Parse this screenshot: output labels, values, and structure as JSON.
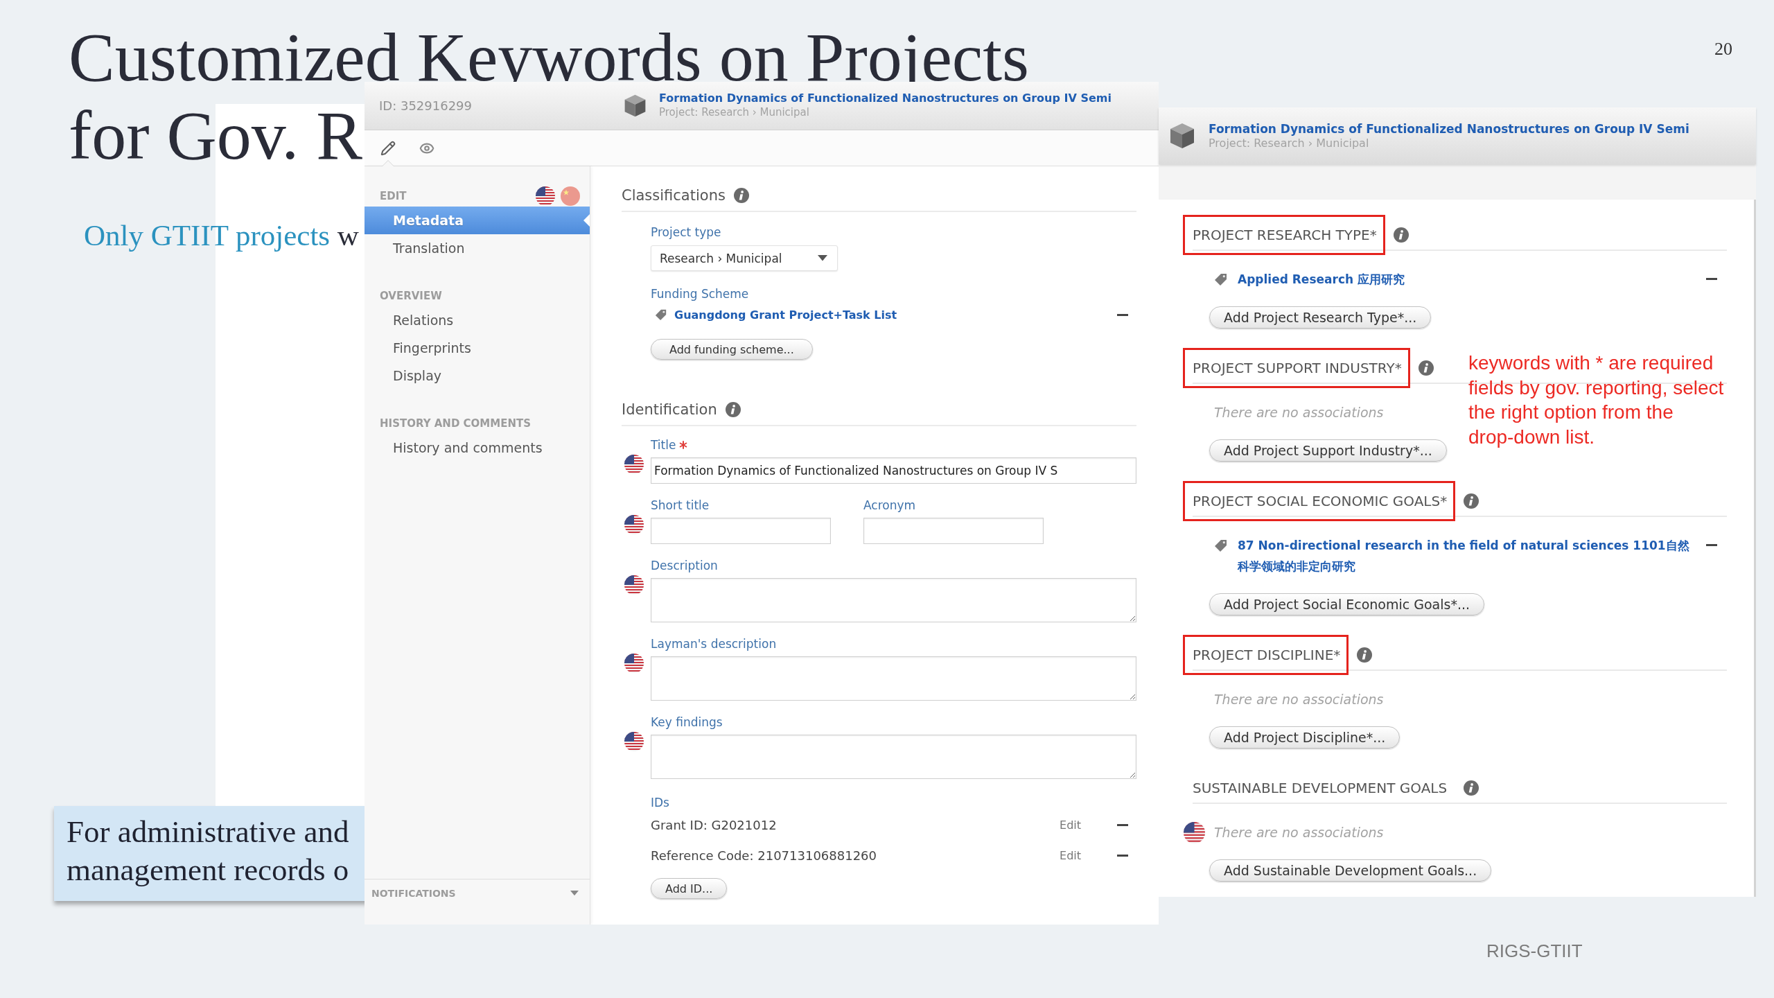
{
  "slide": {
    "title_lines": [
      "Customized Keywords on Projects",
      "for Gov. R"
    ],
    "page_number": "20",
    "intro": {
      "lead": "Only GTIIT projects",
      "rest": "w"
    },
    "callout_lines": [
      "For administrative and",
      "management records o"
    ],
    "annotation_lines": [
      "keywords with * are required",
      "fields by gov. reporting, select",
      "the right option from the",
      "drop-down list."
    ],
    "footer": "RIGS-GTIIT"
  },
  "editor": {
    "id_label": "ID: 352916299",
    "project_title": "Formation Dynamics of Functionalized Nanostructures on Group IV Semi",
    "project_subtitle": "Project: Research › Municipal",
    "modes": [
      {
        "kind": "edit",
        "selected": true
      },
      {
        "kind": "view",
        "selected": false
      }
    ],
    "languages": [
      {
        "kind": "us",
        "selected": true
      },
      {
        "kind": "cn",
        "selected": false
      }
    ],
    "sidebar": [
      {
        "heading": "EDIT",
        "items": [
          {
            "label": "Metadata",
            "selected": true
          },
          {
            "label": "Translation",
            "selected": false
          }
        ]
      },
      {
        "heading": "OVERVIEW",
        "items": [
          {
            "label": "Relations",
            "selected": false
          },
          {
            "label": "Fingerprints",
            "selected": false
          },
          {
            "label": "Display",
            "selected": false
          }
        ]
      },
      {
        "heading": "HISTORY AND COMMENTS",
        "items": [
          {
            "label": "History and comments",
            "selected": false
          }
        ]
      }
    ],
    "notifications": "NOTIFICATIONS",
    "classifications": {
      "heading": "Classifications",
      "project_type": {
        "label": "Project type",
        "value": "Research › Municipal"
      },
      "funding_scheme": {
        "label": "Funding Scheme",
        "items": [
          "Guangdong Grant Project+Task List"
        ],
        "add_button": "Add funding scheme..."
      }
    },
    "identification": {
      "heading": "Identification",
      "fields": [
        {
          "kind": "line",
          "label": "Title",
          "required": true,
          "value": "Formation Dynamics of Functionalized Nanostructures on Group IV S"
        },
        {
          "kind": "pair",
          "items": [
            {
              "label": "Short title",
              "required": false
            },
            {
              "label": "Acronym",
              "required": false
            }
          ]
        },
        {
          "kind": "area",
          "label": "Description",
          "required": false
        },
        {
          "kind": "area",
          "label": "Layman's description",
          "required": false
        },
        {
          "kind": "area",
          "label": "Key findings",
          "required": false
        }
      ],
      "ids": {
        "label": "IDs",
        "rows": [
          {
            "text": "Grant ID: G2021012",
            "action": "Edit"
          },
          {
            "text": "Reference Code: 210713106881260",
            "action": "Edit"
          }
        ],
        "add_button": "Add ID..."
      }
    }
  },
  "keywords": {
    "project_title": "Formation Dynamics of Functionalized Nanostructures on Group IV Semi",
    "project_subtitle": "Project: Research › Municipal",
    "sections": [
      {
        "heading": "PROJECT RESEARCH TYPE*",
        "highlighted": true,
        "localized": false,
        "items": [
          "Applied Research 应用研究"
        ],
        "add_button": "Add Project Research Type*..."
      },
      {
        "heading": "PROJECT SUPPORT INDUSTRY*",
        "highlighted": true,
        "localized": false,
        "empty_text": "There are no associations",
        "add_button": "Add Project Support Industry*..."
      },
      {
        "heading": "PROJECT SOCIAL ECONOMIC GOALS*",
        "highlighted": true,
        "localized": false,
        "items": [
          "87 Non-directional research in the field of natural sciences 1101自然科学领域的非定向研究"
        ],
        "add_button": "Add Project Social Economic Goals*..."
      },
      {
        "heading": "PROJECT DISCIPLINE*",
        "highlighted": true,
        "localized": false,
        "empty_text": "There are no associations",
        "add_button": "Add Project Discipline*..."
      },
      {
        "heading": "SUSTAINABLE DEVELOPMENT GOALS",
        "highlighted": false,
        "localized": true,
        "empty_text": "There are no associations",
        "add_button": "Add Sustainable Development Goals..."
      }
    ]
  }
}
